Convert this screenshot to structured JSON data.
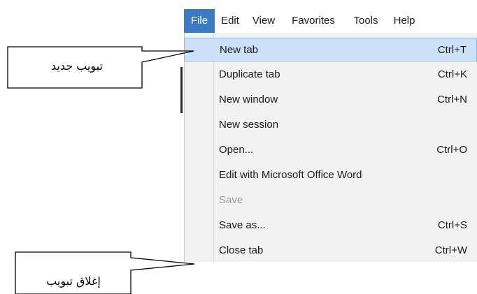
{
  "menubar": {
    "items": [
      {
        "label": "File",
        "active": true
      },
      {
        "label": "Edit",
        "active": false
      },
      {
        "label": "View",
        "active": false
      },
      {
        "label": "Favorites",
        "active": false
      },
      {
        "label": "Tools",
        "active": false
      },
      {
        "label": "Help",
        "active": false
      }
    ]
  },
  "file_menu": {
    "items": [
      {
        "label": "New tab",
        "shortcut": "Ctrl+T",
        "highlighted": true,
        "disabled": false
      },
      {
        "label": "Duplicate tab",
        "shortcut": "Ctrl+K",
        "highlighted": false,
        "disabled": false
      },
      {
        "label": "New window",
        "shortcut": "Ctrl+N",
        "highlighted": false,
        "disabled": false
      },
      {
        "label": "New session",
        "shortcut": "",
        "highlighted": false,
        "disabled": false
      },
      {
        "label": "Open...",
        "shortcut": "Ctrl+O",
        "highlighted": false,
        "disabled": false
      },
      {
        "label": "Edit with Microsoft Office Word",
        "shortcut": "",
        "highlighted": false,
        "disabled": false
      },
      {
        "label": "Save",
        "shortcut": "",
        "highlighted": false,
        "disabled": true
      },
      {
        "label": "Save as...",
        "shortcut": "Ctrl+S",
        "highlighted": false,
        "disabled": false
      },
      {
        "label": "Close tab",
        "shortcut": "Ctrl+W",
        "highlighted": false,
        "disabled": false
      }
    ]
  },
  "callouts": {
    "new_tab": "تبويب جديد",
    "close_tab": "إغلاق تبويب"
  },
  "colors": {
    "menu_active": "#3c79c4",
    "item_highlight": "#cce1f7",
    "menu_background": "#f2f2f2"
  }
}
